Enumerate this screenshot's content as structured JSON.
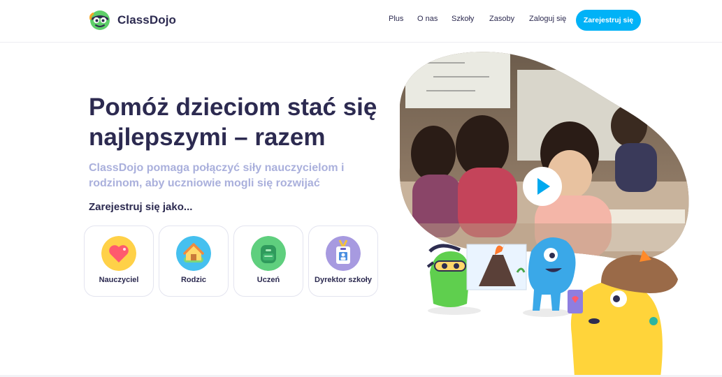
{
  "header": {
    "logo_text": "ClassDojo",
    "nav": [
      "Plus",
      "O nas",
      "Szkoły",
      "Zasoby",
      "Zaloguj się"
    ],
    "signup_button": "Zarejestruj się"
  },
  "hero": {
    "title_line1": "Pomóż dzieciom stać się",
    "title_line2": "najlepszymi – razem",
    "subtitle_line1": "ClassDojo pomaga połączyć siły nauczycielom i",
    "subtitle_line2": "rodzinom, aby uczniowie mogli się rozwijać",
    "register_as": "Zarejestruj się jako..."
  },
  "roles": [
    {
      "label": "Nauczyciel",
      "icon": "heart-icon",
      "color": "#ffd148"
    },
    {
      "label": "Rodzic",
      "icon": "house-icon",
      "color": "#45c0ef"
    },
    {
      "label": "Uczeń",
      "icon": "backpack-icon",
      "color": "#5fcf7e"
    },
    {
      "label": "Dyrektor szkoły",
      "icon": "id-badge-icon",
      "color": "#a79ae0"
    }
  ],
  "video": {
    "play_icon": "play-icon"
  },
  "colors": {
    "accent": "#00b2f7",
    "text": "#2c2a50",
    "subtitle": "#aab0dc"
  }
}
